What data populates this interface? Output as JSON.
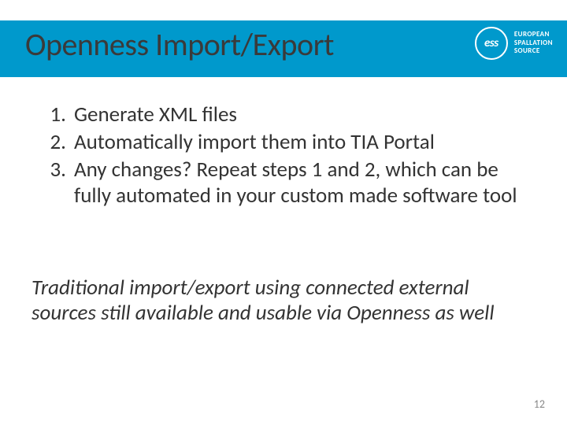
{
  "header": {
    "title": "Openness Import/Export",
    "logo_abbr": "ess",
    "logo_line1": "EUROPEAN",
    "logo_line2": "SPALLATION",
    "logo_line3": "SOURCE"
  },
  "steps": [
    "Generate XML files",
    "Automatically import them into TIA Portal",
    "Any changes? Repeat steps 1 and 2, which can be fully automated in your custom made software tool"
  ],
  "note": "Traditional import/export using connected external sources still available and usable via Openness as well",
  "page_number": "12"
}
